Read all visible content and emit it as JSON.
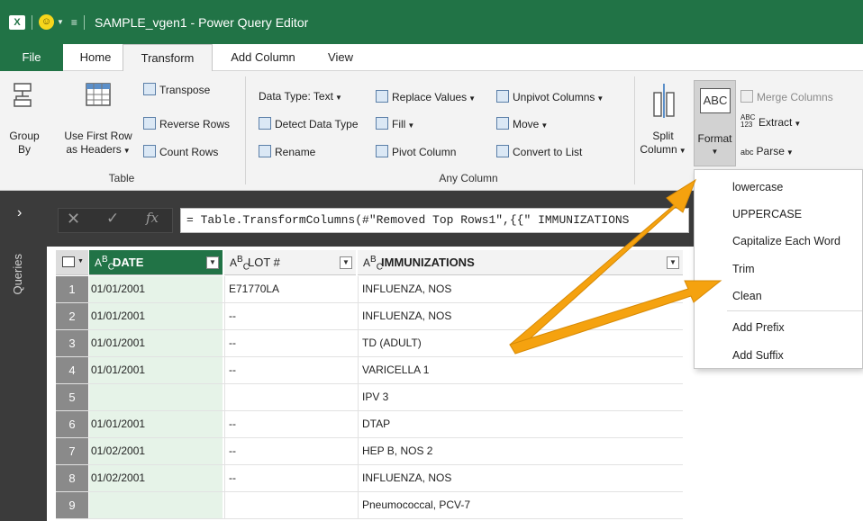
{
  "titlebar": {
    "title": "SAMPLE_vgen1 - Power Query Editor",
    "logo": "X",
    "smiley": "☺"
  },
  "tabs": {
    "file": "File",
    "home": "Home",
    "transform": "Transform",
    "add_column": "Add Column",
    "view": "View"
  },
  "ribbon": {
    "group_by_1": "Group",
    "group_by_2": "By",
    "use_first_row_1": "Use First Row",
    "use_first_row_2": "as Headers",
    "transpose": "Transpose",
    "reverse_rows": "Reverse Rows",
    "count_rows": "Count Rows",
    "table_group": "Table",
    "data_type": "Data Type: Text",
    "detect_data_type": "Detect Data Type",
    "rename": "Rename",
    "replace_values": "Replace Values",
    "fill": "Fill",
    "pivot_column": "Pivot Column",
    "unpivot_columns": "Unpivot Columns",
    "move": "Move",
    "convert_to_list": "Convert to List",
    "any_column_group": "Any Column",
    "split_1": "Split",
    "split_2": "Column",
    "format": "Format",
    "merge_columns": "Merge Columns",
    "extract": "Extract",
    "parse": "Parse",
    "abc_icon": "ABC",
    "abc123_top": "ABC",
    "abc123_bot": "123",
    "abc_small": "abc"
  },
  "sidebar": {
    "label": "Queries",
    "chevron": "›"
  },
  "formula": {
    "cancel": "✕",
    "commit": "✓",
    "fx": "fx",
    "text": "= Table.TransformColumns(#\"Removed Top Rows1\",{{\"    IMMUNIZATIONS"
  },
  "grid": {
    "type_icon": "ABC",
    "type_a": "A",
    "type_b": "B",
    "type_c": "C",
    "columns": [
      "DATE",
      "LOT #",
      "IMMUNIZATIONS"
    ],
    "rows": [
      {
        "idx": "1",
        "date": "01/01/2001",
        "lot": "E71770LA",
        "imm": "INFLUENZA, NOS"
      },
      {
        "idx": "2",
        "date": "01/01/2001",
        "lot": "--",
        "imm": "INFLUENZA, NOS"
      },
      {
        "idx": "3",
        "date": "01/01/2001",
        "lot": "--",
        "imm": "TD (ADULT)"
      },
      {
        "idx": "4",
        "date": "01/01/2001",
        "lot": "--",
        "imm": "VARICELLA 1"
      },
      {
        "idx": "5",
        "date": "",
        "lot": "",
        "imm": "IPV 3"
      },
      {
        "idx": "6",
        "date": "01/01/2001",
        "lot": "--",
        "imm": "DTAP"
      },
      {
        "idx": "7",
        "date": "01/02/2001",
        "lot": "--",
        "imm": "HEP B, NOS 2"
      },
      {
        "idx": "8",
        "date": "01/02/2001",
        "lot": "--",
        "imm": "INFLUENZA, NOS"
      },
      {
        "idx": "9",
        "date": "",
        "lot": "",
        "imm": "Pneumococcal, PCV-7"
      }
    ]
  },
  "format_menu": [
    "lowercase",
    "UPPERCASE",
    "Capitalize Each Word",
    "Trim",
    "Clean",
    "Add Prefix",
    "Add Suffix"
  ],
  "colors": {
    "excel_green": "#217346",
    "arrow": "#f5a20f",
    "date_fill": "#e6f3e8"
  }
}
